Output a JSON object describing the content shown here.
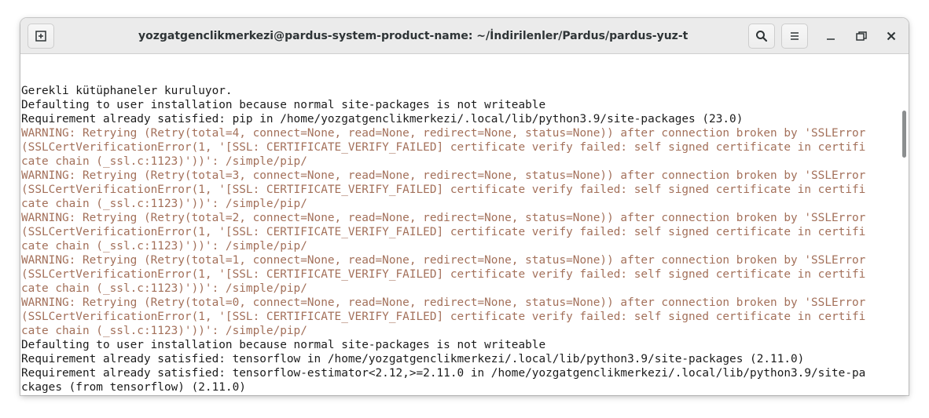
{
  "window": {
    "title": "yozgatgenclikmerkezi@pardus-system-product-name: ~/İndirilenler/Pardus/pardus-yuz-tanima"
  },
  "headerbar": {
    "new_tab_icon": "new-tab-icon",
    "search_icon": "search-icon",
    "menu_icon": "hamburger-menu-icon",
    "minimize_icon": "minimize-icon",
    "maximize_icon": "maximize-icon",
    "close_icon": "close-icon"
  },
  "colors": {
    "warning_text": "#a3705a",
    "normal_text": "#1b1b1b",
    "headerbar_bg": "#ebebeb"
  },
  "terminal": {
    "lines": [
      {
        "text": "Gerekli kütüphaneler kuruluyor.",
        "type": "normal"
      },
      {
        "text": "Defaulting to user installation because normal site-packages is not writeable",
        "type": "normal"
      },
      {
        "text": "Requirement already satisfied: pip in /home/yozgatgenclikmerkezi/.local/lib/python3.9/site-packages (23.0)",
        "type": "normal"
      },
      {
        "text": "WARNING: Retrying (Retry(total=4, connect=None, read=None, redirect=None, status=None)) after connection broken by 'SSLError",
        "type": "warn"
      },
      {
        "text": "(SSLCertVerificationError(1, '[SSL: CERTIFICATE_VERIFY_FAILED] certificate verify failed: self signed certificate in certifi",
        "type": "warn"
      },
      {
        "text": "cate chain (_ssl.c:1123)'))': /simple/pip/",
        "type": "warn"
      },
      {
        "text": "WARNING: Retrying (Retry(total=3, connect=None, read=None, redirect=None, status=None)) after connection broken by 'SSLError",
        "type": "warn"
      },
      {
        "text": "(SSLCertVerificationError(1, '[SSL: CERTIFICATE_VERIFY_FAILED] certificate verify failed: self signed certificate in certifi",
        "type": "warn"
      },
      {
        "text": "cate chain (_ssl.c:1123)'))': /simple/pip/",
        "type": "warn"
      },
      {
        "text": "WARNING: Retrying (Retry(total=2, connect=None, read=None, redirect=None, status=None)) after connection broken by 'SSLError",
        "type": "warn"
      },
      {
        "text": "(SSLCertVerificationError(1, '[SSL: CERTIFICATE_VERIFY_FAILED] certificate verify failed: self signed certificate in certifi",
        "type": "warn"
      },
      {
        "text": "cate chain (_ssl.c:1123)'))': /simple/pip/",
        "type": "warn"
      },
      {
        "text": "WARNING: Retrying (Retry(total=1, connect=None, read=None, redirect=None, status=None)) after connection broken by 'SSLError",
        "type": "warn"
      },
      {
        "text": "(SSLCertVerificationError(1, '[SSL: CERTIFICATE_VERIFY_FAILED] certificate verify failed: self signed certificate in certifi",
        "type": "warn"
      },
      {
        "text": "cate chain (_ssl.c:1123)'))': /simple/pip/",
        "type": "warn"
      },
      {
        "text": "WARNING: Retrying (Retry(total=0, connect=None, read=None, redirect=None, status=None)) after connection broken by 'SSLError",
        "type": "warn"
      },
      {
        "text": "(SSLCertVerificationError(1, '[SSL: CERTIFICATE_VERIFY_FAILED] certificate verify failed: self signed certificate in certifi",
        "type": "warn"
      },
      {
        "text": "cate chain (_ssl.c:1123)'))': /simple/pip/",
        "type": "warn"
      },
      {
        "text": "Defaulting to user installation because normal site-packages is not writeable",
        "type": "normal"
      },
      {
        "text": "Requirement already satisfied: tensorflow in /home/yozgatgenclikmerkezi/.local/lib/python3.9/site-packages (2.11.0)",
        "type": "normal"
      },
      {
        "text": "Requirement already satisfied: tensorflow-estimator<2.12,>=2.11.0 in /home/yozgatgenclikmerkezi/.local/lib/python3.9/site-pa",
        "type": "normal"
      },
      {
        "text": "ckages (from tensorflow) (2.11.0)",
        "type": "normal"
      }
    ]
  }
}
